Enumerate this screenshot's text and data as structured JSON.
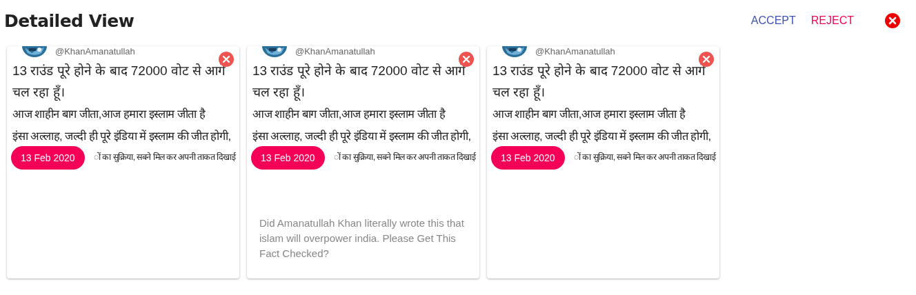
{
  "header": {
    "title": "Detailed View",
    "actions": [
      {
        "label": "ACCEPT",
        "kind": "accept"
      },
      {
        "label": "REJECT",
        "kind": "reject"
      }
    ]
  },
  "cards": [
    {
      "handle": "@KhanAmanatullah",
      "lines": [
        "13 राउंड पूरे होने के बाद 72000 वोट से आगे चल रहा हूँ।",
        "आज शाहीन बाग जीता,आज हमारा इस्लाम जीता है",
        "इंसा अल्लाह, जल्दी ही पूरे इंडिया में इस्लाम की जीत होगी,"
      ],
      "covered_line": "ों का सुक्रिया, सबने मिल कर अपनी ताकत दिखाई",
      "date": "13 Feb 2020"
    },
    {
      "handle": "@KhanAmanatullah",
      "lines": [
        "13 राउंड पूरे होने के बाद 72000 वोट से आगे चल रहा हूँ।",
        "आज शाहीन बाग जीता,आज हमारा इस्लाम जीता है",
        "इंसा अल्लाह, जल्दी ही पूरे इंडिया में इस्लाम की जीत होगी,"
      ],
      "covered_line": "ों का सुक्रिया, सबने मिल कर अपनी ताकत दिखाई",
      "date": "13 Feb 2020",
      "description": "Did Amanatullah Khan literally wrote this that islam will overpower india. Please Get This Fact Checked?"
    },
    {
      "handle": "@KhanAmanatullah",
      "lines": [
        "13 राउंड पूरे होने के बाद 72000 वोट से आगे चल रहा हूँ।",
        "आज शाहीन बाग जीता,आज हमारा इस्लाम जीता है",
        "इंसा अल्लाह, जल्दी ही पूरे इंडिया में इस्लाम की जीत होगी,"
      ],
      "covered_line": "ों का सुक्रिया, सबने मिल कर अपनी ताकत दिखाई",
      "date": "13 Feb 2020"
    }
  ]
}
